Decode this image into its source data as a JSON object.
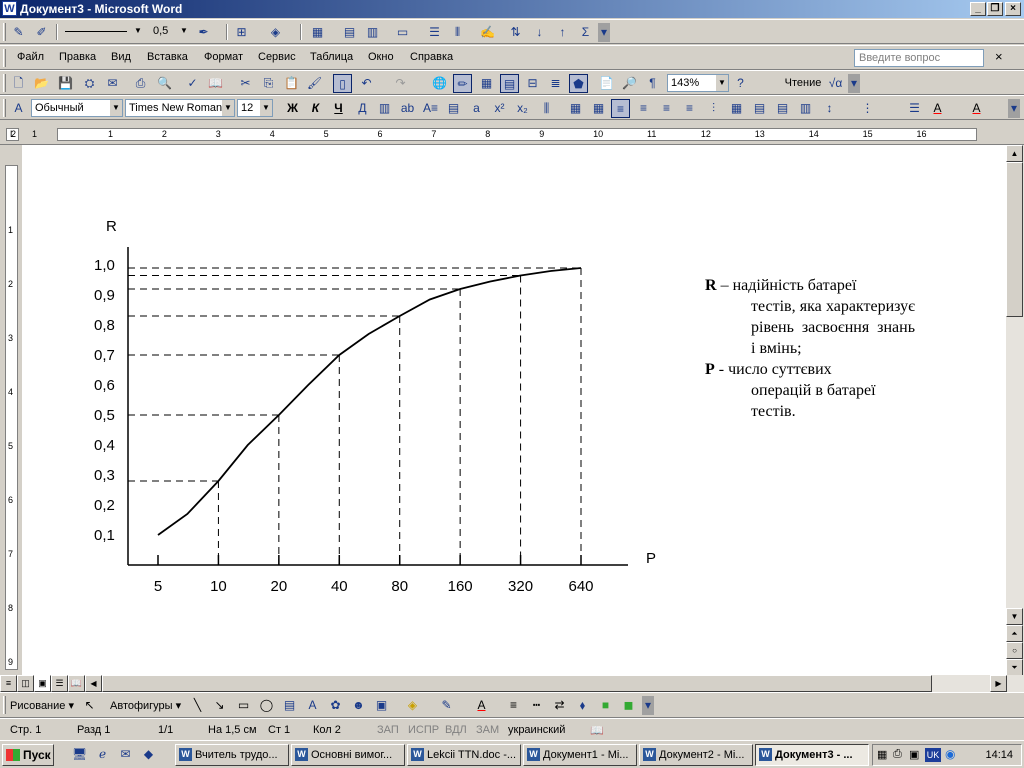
{
  "window": {
    "title": "Документ3 - Microsoft Word",
    "app_icon": "W"
  },
  "toolbar1": {
    "line_width": "0,5"
  },
  "menu": {
    "items": [
      "Файл",
      "Правка",
      "Вид",
      "Вставка",
      "Формат",
      "Сервис",
      "Таблица",
      "Окно",
      "Справка"
    ],
    "ask_placeholder": "Введите вопрос",
    "close": "×"
  },
  "standard": {
    "zoom": "143%",
    "read_label": "Чтение"
  },
  "formatting": {
    "style": "Обычный",
    "font": "Times New Roman",
    "size": "12",
    "bold": "Ж",
    "italic": "К",
    "underline": "Ч"
  },
  "ruler": {
    "numbers": [
      "1",
      "2",
      "1",
      "2",
      "3",
      "4",
      "5",
      "6",
      "7",
      "8",
      "9",
      "10",
      "11",
      "12",
      "13",
      "14",
      "15",
      "16"
    ],
    "vnumbers": [
      "1",
      "2",
      "3",
      "4",
      "5",
      "6",
      "7",
      "8",
      "9"
    ]
  },
  "chart_data": {
    "type": "line",
    "ylabel": "R",
    "xlabel": "P",
    "x_ticks": [
      "5",
      "10",
      "20",
      "40",
      "80",
      "160",
      "320",
      "640"
    ],
    "y_ticks": [
      "0,1",
      "0,2",
      "0,3",
      "0,4",
      "0,5",
      "0,6",
      "0,7",
      "0,8",
      "0,9",
      "1,0"
    ],
    "ylim": [
      0,
      1.1
    ],
    "x_scale": "log",
    "series": [
      {
        "x": [
          5,
          7,
          10,
          14,
          20,
          28,
          40,
          56,
          80,
          113,
          160,
          226,
          320,
          452,
          640
        ],
        "y": [
          0.1,
          0.17,
          0.28,
          0.4,
          0.5,
          0.6,
          0.7,
          0.77,
          0.83,
          0.885,
          0.92,
          0.945,
          0.965,
          0.98,
          0.99
        ]
      }
    ],
    "guides": [
      {
        "x": 10,
        "y": 0.28
      },
      {
        "x": 20,
        "y": 0.5
      },
      {
        "x": 40,
        "y": 0.7
      },
      {
        "x": 80,
        "y": 0.83
      },
      {
        "x": 160,
        "y": 0.92
      },
      {
        "x": 320,
        "y": 0.965
      },
      {
        "x": 640,
        "y": 0.99
      }
    ],
    "grid": false
  },
  "legend": {
    "r_key": "R",
    "r_text_first": "– надійність батареї",
    "r_text_rest": "тестів, яка характеризує рівень засвоєння знань і вмінь;",
    "p_key": "P",
    "p_text_first": "- число суттєвих",
    "p_text_rest": "операцій в батареї тестів."
  },
  "drawing": {
    "draw_label": "Рисование ▾",
    "autoshapes_label": "Автофигуры ▾"
  },
  "status": {
    "page": "Стр. 1",
    "section": "Разд 1",
    "pages": "1/1",
    "at": "На 1,5 см",
    "line": "Ст 1",
    "col": "Кол 2",
    "rec": "ЗАП",
    "trk": "ИСПР",
    "ext": "ВДЛ",
    "ovr": "ЗАМ",
    "lang": "украинский"
  },
  "taskbar": {
    "start": "Пуск",
    "tasks": [
      "Вчитель трудо...",
      "Основні вимог...",
      "Lekcii TTN.doc -...",
      "Документ1 - Mi...",
      "Документ2 - Mi...",
      "Документ3 - ..."
    ],
    "lang": "UK",
    "clock": "14:14"
  }
}
